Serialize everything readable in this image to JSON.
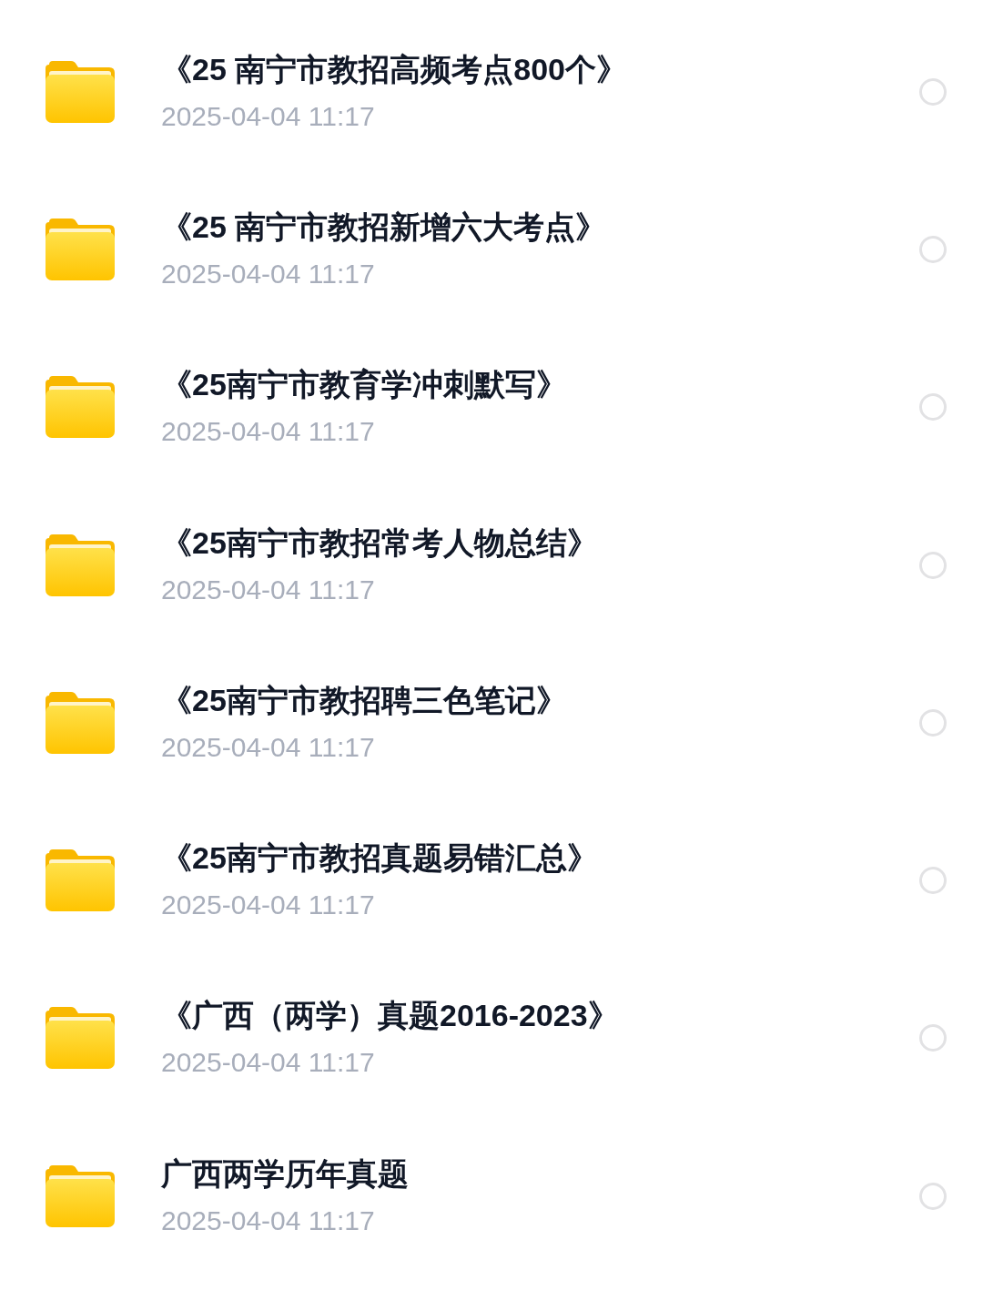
{
  "files": [
    {
      "name": "《25 南宁市教招高频考点800个》",
      "modified": "2025-04-04 11:17",
      "selected": false
    },
    {
      "name": "《25 南宁市教招新增六大考点》",
      "modified": "2025-04-04 11:17",
      "selected": false
    },
    {
      "name": "《25南宁市教育学冲刺默写》",
      "modified": "2025-04-04 11:17",
      "selected": false
    },
    {
      "name": "《25南宁市教招常考人物总结》",
      "modified": "2025-04-04 11:17",
      "selected": false
    },
    {
      "name": "《25南宁市教招聘三色笔记》",
      "modified": "2025-04-04 11:17",
      "selected": false
    },
    {
      "name": "《25南宁市教招真题易错汇总》",
      "modified": "2025-04-04 11:17",
      "selected": false
    },
    {
      "name": "《广西（两学）真题2016-2023》",
      "modified": "2025-04-04 11:17",
      "selected": false
    },
    {
      "name": "广西两学历年真题",
      "modified": "2025-04-04 11:17",
      "selected": false
    }
  ]
}
